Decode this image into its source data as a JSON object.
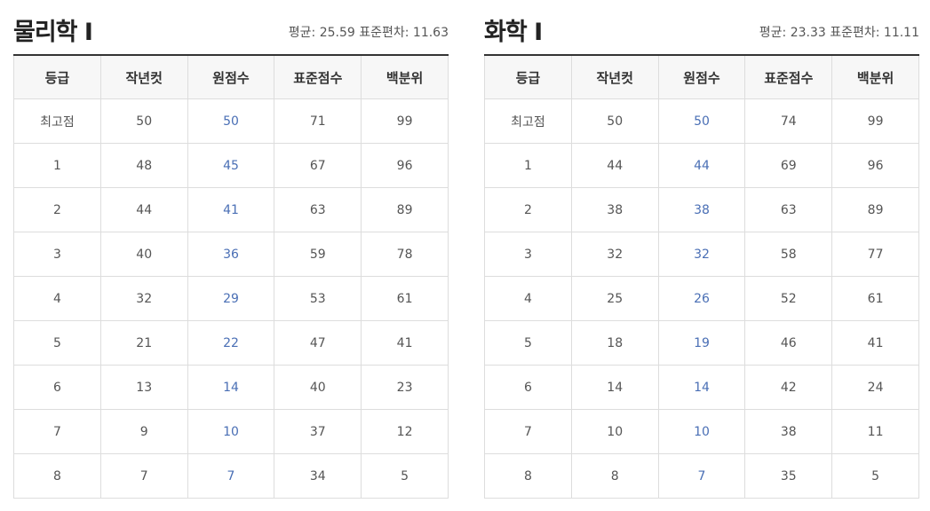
{
  "columns": [
    "등급",
    "작년컷",
    "원점수",
    "표준점수",
    "백분위"
  ],
  "accent_color": "#4a6fb5",
  "subjects": [
    {
      "title": "물리학 Ⅰ",
      "stats": "평균: 25.59 표준편차: 11.63",
      "rows": [
        [
          "최고점",
          "50",
          "50",
          "71",
          "99"
        ],
        [
          "1",
          "48",
          "45",
          "67",
          "96"
        ],
        [
          "2",
          "44",
          "41",
          "63",
          "89"
        ],
        [
          "3",
          "40",
          "36",
          "59",
          "78"
        ],
        [
          "4",
          "32",
          "29",
          "53",
          "61"
        ],
        [
          "5",
          "21",
          "22",
          "47",
          "41"
        ],
        [
          "6",
          "13",
          "14",
          "40",
          "23"
        ],
        [
          "7",
          "9",
          "10",
          "37",
          "12"
        ],
        [
          "8",
          "7",
          "7",
          "34",
          "5"
        ]
      ]
    },
    {
      "title": "화학 Ⅰ",
      "stats": "평균: 23.33 표준편차: 11.11",
      "rows": [
        [
          "최고점",
          "50",
          "50",
          "74",
          "99"
        ],
        [
          "1",
          "44",
          "44",
          "69",
          "96"
        ],
        [
          "2",
          "38",
          "38",
          "63",
          "89"
        ],
        [
          "3",
          "32",
          "32",
          "58",
          "77"
        ],
        [
          "4",
          "25",
          "26",
          "52",
          "61"
        ],
        [
          "5",
          "18",
          "19",
          "46",
          "41"
        ],
        [
          "6",
          "14",
          "14",
          "42",
          "24"
        ],
        [
          "7",
          "10",
          "10",
          "38",
          "11"
        ],
        [
          "8",
          "8",
          "7",
          "35",
          "5"
        ]
      ]
    }
  ]
}
